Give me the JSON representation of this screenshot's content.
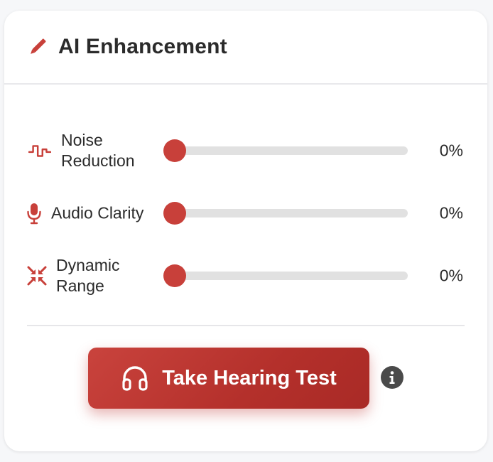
{
  "panel": {
    "title": "AI Enhancement",
    "title_icon": "pencil-icon",
    "accent_color": "#c8403a"
  },
  "controls": [
    {
      "label": "Noise Reduction",
      "icon": "waveform-icon",
      "value": 0,
      "value_text": "0%"
    },
    {
      "label": "Audio Clarity",
      "icon": "microphone-icon",
      "value": 0,
      "value_text": "0%"
    },
    {
      "label": "Dynamic Range",
      "icon": "compress-arrows-icon",
      "value": 0,
      "value_text": "0%"
    }
  ],
  "actions": {
    "hearing_test_label": "Take Hearing Test",
    "hearing_test_icon": "headphones-icon",
    "info_icon": "info-icon"
  }
}
